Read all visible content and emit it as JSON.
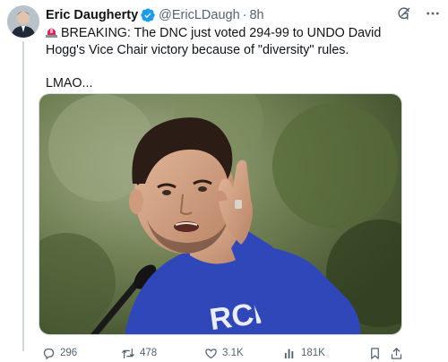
{
  "author": {
    "display_name": "Eric Daugherty",
    "handle": "@EricLDaugh",
    "separator": "·",
    "time": "8h",
    "verified": true
  },
  "tweet": {
    "line1": "BREAKING: The DNC just voted 294-99 to UNDO David Hogg's Vice Chair victory because of \"diversity\" rules.",
    "line2": "LMAO..."
  },
  "icons": {
    "verified": "verified-badge-icon",
    "grok": "grok-icon",
    "more": "more-icon",
    "siren": "rotating-light-emoji-icon",
    "reply": "reply-icon",
    "retweet": "retweet-icon",
    "like": "heart-icon",
    "views": "views-chart-icon",
    "bookmark": "bookmark-icon",
    "share": "share-icon"
  },
  "metrics": {
    "replies": "296",
    "retweets": "478",
    "likes": "3.1K",
    "views": "181K"
  },
  "media": {
    "shirt_text": "RCH"
  },
  "colors": {
    "text": "#0f1419",
    "secondary": "#536471",
    "verified": "#1d9bf0",
    "shirt": "#2f47b8",
    "siren": "#e0245e"
  }
}
